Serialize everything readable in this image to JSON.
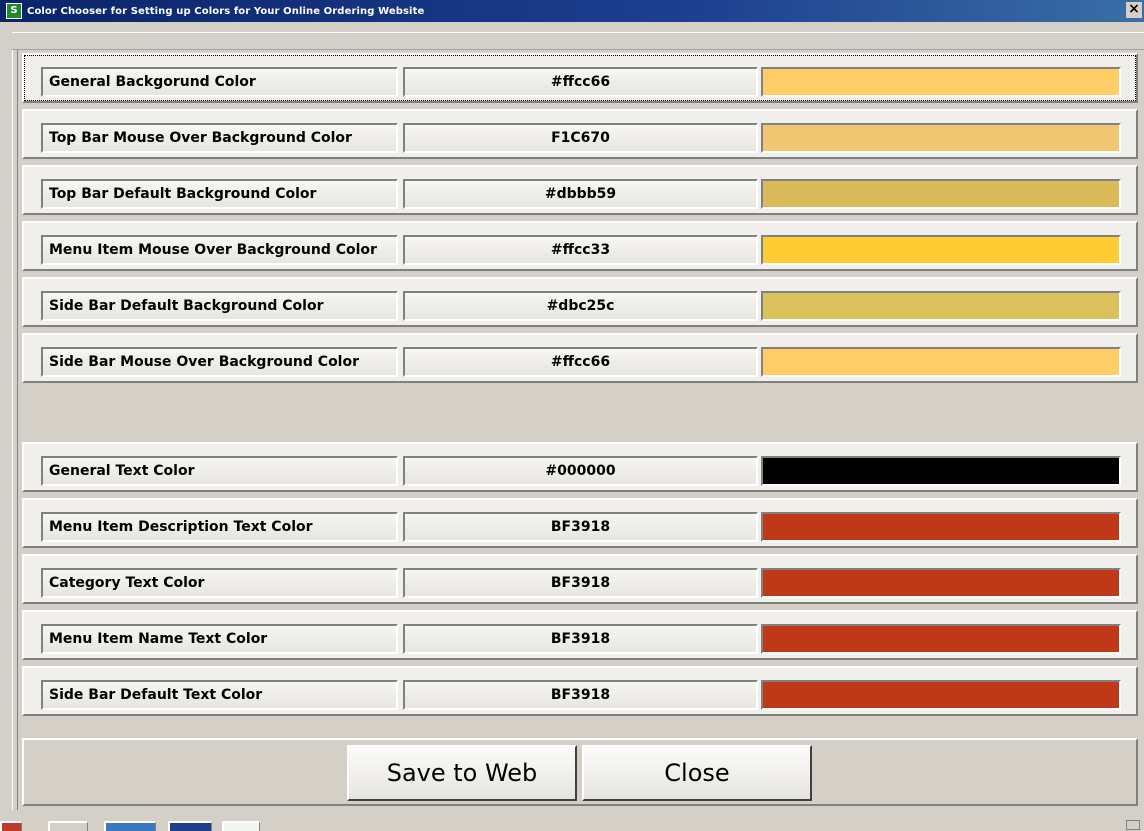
{
  "window": {
    "title": "Color Chooser for Setting up Colors for Your Online Ordering Website",
    "icon": "app-logo-icon",
    "icon_glyph": "S",
    "close_glyph": "×"
  },
  "background_colors": [
    {
      "label": "General Backgorund Color",
      "value": "#ffcc66",
      "swatch": "#ffcc66"
    },
    {
      "label": "Top Bar Mouse Over Background Color",
      "value": "F1C670",
      "swatch": "#f1c670"
    },
    {
      "label": "Top Bar Default Background Color",
      "value": "#dbbb59",
      "swatch": "#dbbb59"
    },
    {
      "label": "Menu Item Mouse Over Background Color",
      "value": "#ffcc33",
      "swatch": "#ffcc33"
    },
    {
      "label": "Side Bar Default Background Color",
      "value": "#dbc25c",
      "swatch": "#dbc25c"
    },
    {
      "label": "Side Bar Mouse Over Background Color",
      "value": "#ffcc66",
      "swatch": "#ffcc66"
    }
  ],
  "text_colors": [
    {
      "label": "General Text Color",
      "value": "#000000",
      "swatch": "#000000"
    },
    {
      "label": "Menu Item Description Text Color",
      "value": "BF3918",
      "swatch": "#bf3918"
    },
    {
      "label": "Category Text Color",
      "value": "BF3918",
      "swatch": "#bf3918"
    },
    {
      "label": "Menu Item Name Text Color",
      "value": "BF3918",
      "swatch": "#bf3918"
    },
    {
      "label": "Side Bar Default Text Color",
      "value": "BF3918",
      "swatch": "#bf3918"
    }
  ],
  "footer": {
    "save_label": "Save to Web",
    "close_label": "Close"
  },
  "theme": {
    "title_bar": "#0a246a",
    "panel": "#d4d0c8",
    "row_bg": "#f0efeb"
  }
}
